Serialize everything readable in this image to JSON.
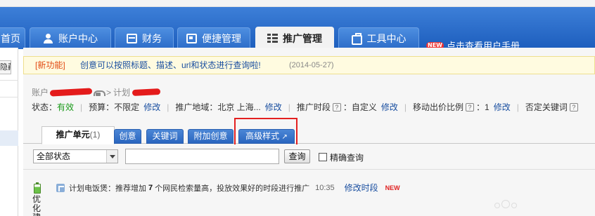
{
  "top_strip": {
    "text": ""
  },
  "nav": {
    "tabs": [
      {
        "label": "首页",
        "icon": "home-icon",
        "active": false
      },
      {
        "label": "账户中心",
        "icon": "user-icon",
        "active": false
      },
      {
        "label": "财务",
        "icon": "card-icon",
        "active": false
      },
      {
        "label": "便捷管理",
        "icon": "screen-icon",
        "active": false
      },
      {
        "label": "推广管理",
        "icon": "grid-icon",
        "active": true
      },
      {
        "label": "工具中心",
        "icon": "briefcase-icon",
        "active": false
      }
    ],
    "new_badge": "NEW",
    "manual_link": "点击查看用户手册",
    "bar_color": "#2c6cc8"
  },
  "sidebar": {
    "button_label": "隐藏"
  },
  "notice": {
    "tag": "[新功能]",
    "message": "创意可以按照标题、描述、url和状态进行查询啦!",
    "date": "(2014-05-27)"
  },
  "breadcrumb": {
    "account_label": "账户",
    "separator": ">",
    "plan_label": "计划"
  },
  "plan_info": {
    "status_label": "状态：",
    "status_value": "有效",
    "budget_label": "预算：",
    "budget_value": "不限定",
    "budget_edit": "修改",
    "region_label": "推广地域：",
    "region_value": "北京 上海...",
    "region_edit": "修改",
    "time_label": "推广时段",
    "time_value": "：自定义",
    "time_edit": "修改",
    "mobile_label": "移动出价比例",
    "mobile_value": "：1",
    "mobile_edit": "修改",
    "negative_label": "否定关键词"
  },
  "subtabs": {
    "unit_label": "推广单元",
    "unit_count": "(1)",
    "creative": "创意",
    "keyword": "关键词",
    "extra_creative": "附加创意",
    "advanced_style": "高级样式"
  },
  "filter": {
    "status_selected": "全部状态",
    "query_value": "",
    "query_button": "查询",
    "exact_label": "精确查询"
  },
  "tip": {
    "prefix": "计划电饭煲：推荐增加",
    "count": "7",
    "suffix": "个网民检索量高，投放效果好的时段进行推广",
    "time": "10:35",
    "action": "修改时段",
    "badge": "NEW"
  },
  "optimize": {
    "label": "优化建"
  }
}
